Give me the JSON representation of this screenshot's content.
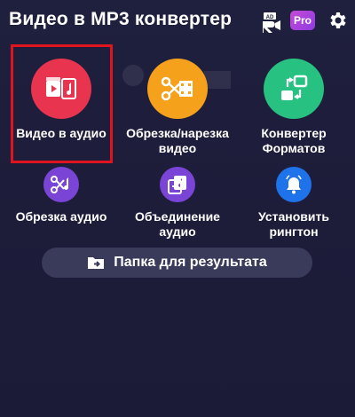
{
  "header": {
    "title": "Видео в MP3 конвертер",
    "ads_icon": "no-ads-icon",
    "pro_label": "Pro",
    "settings_icon": "gear-icon"
  },
  "features_main": [
    {
      "label": "Видео в аудио",
      "icon": "video-to-audio-icon",
      "color": "#e8344e"
    },
    {
      "label": "Обрезка/нарезка\nвидео",
      "icon": "scissors-film-icon",
      "color": "#f5a11c"
    },
    {
      "label": "Конвертер\nФорматов",
      "icon": "convert-format-icon",
      "color": "#27c281"
    }
  ],
  "features_secondary": [
    {
      "label": "Обрезка аудио",
      "icon": "scissors-music-icon",
      "color": "#7a45d6"
    },
    {
      "label": "Объединение\nаудио",
      "icon": "merge-audio-icon",
      "color": "#7a45d6"
    },
    {
      "label": "Установить\nрингтон",
      "icon": "bell-icon",
      "color": "#1f73ea"
    }
  ],
  "result_button": {
    "label": "Папка для результата",
    "icon": "folder-icon"
  }
}
